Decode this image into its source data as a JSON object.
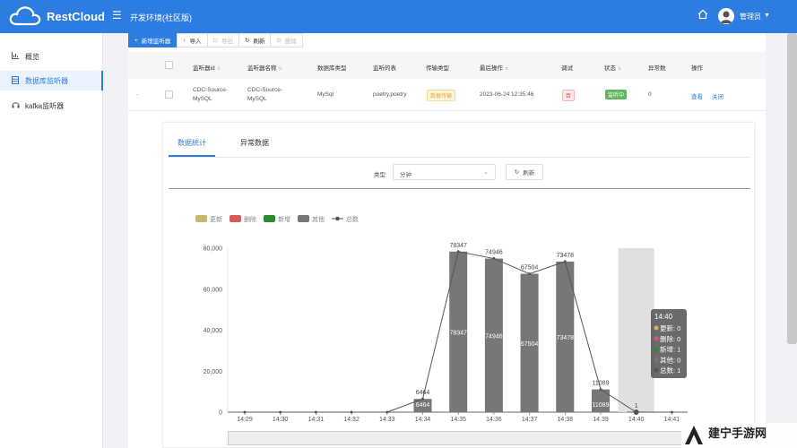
{
  "header": {
    "brand": "RestCloud",
    "environment": "开发环境(社区版)",
    "user": "管理员"
  },
  "sidebar": {
    "items": [
      {
        "label": "概览",
        "icon": "bar-chart-icon"
      },
      {
        "label": "数据库监听器",
        "icon": "database-icon",
        "active": true
      },
      {
        "label": "kafka监听器",
        "icon": "headset-icon"
      }
    ]
  },
  "toolbar": {
    "add_label": "新增监听器",
    "import_label": "导入",
    "export_label": "导出",
    "refresh_label": "刷新",
    "delete_label": "删除"
  },
  "table": {
    "headers": [
      "监听器id",
      "监听器名称",
      "数据库类型",
      "监听的表",
      "传输类型",
      "最后操作",
      "调试",
      "状态",
      "异常数",
      "操作"
    ],
    "row": {
      "id": "CDC-Source-MySQL",
      "name": "CDC-Source-MySQL",
      "db_type": "MySql",
      "table": "poetry.poetry",
      "transfer_type": "数据传输",
      "last_op": "2023-06-24 12:35:46",
      "debug": "否",
      "status": "监听中",
      "errors": "0",
      "action_view": "查看",
      "action_close": "关闭"
    }
  },
  "detail": {
    "tab_stats": "数据统计",
    "tab_errors": "异常数据",
    "type_label": "类型:",
    "type_value": "分钟",
    "refresh_label": "刷新"
  },
  "chart_data": {
    "type": "bar",
    "categories": [
      "14:29",
      "14:30",
      "14:31",
      "14:32",
      "14:33",
      "14:34",
      "14:35",
      "14:36",
      "14:37",
      "14:38",
      "14:39",
      "14:40",
      "14:41"
    ],
    "series": [
      {
        "name": "更新",
        "values": [
          0,
          0,
          0,
          0,
          0,
          0,
          0,
          0,
          0,
          0,
          0,
          0,
          0
        ],
        "color": "#c5b66f"
      },
      {
        "name": "删除",
        "values": [
          0,
          0,
          0,
          0,
          0,
          0,
          0,
          0,
          0,
          0,
          0,
          0,
          0
        ],
        "color": "#d55b5b"
      },
      {
        "name": "新增",
        "values": [
          0,
          0,
          0,
          0,
          0,
          0,
          0,
          0,
          0,
          0,
          0,
          1,
          0
        ],
        "color": "#2e8b2e"
      },
      {
        "name": "其他",
        "values": [
          0,
          0,
          0,
          0,
          0,
          6464,
          78347,
          74946,
          67504,
          73478,
          11089,
          0,
          0
        ],
        "color": "#777777"
      },
      {
        "name": "总数",
        "values": [
          0,
          0,
          0,
          0,
          0,
          6464,
          78347,
          74946,
          67504,
          73478,
          11089,
          1,
          0
        ],
        "color": "#555555",
        "kind": "line"
      }
    ],
    "yticks": [
      "0",
      "20,000",
      "40,000",
      "60,000",
      "80,000"
    ],
    "ylim": [
      0,
      80000
    ],
    "legend": "top-left",
    "highlight": "14:40",
    "tooltip": {
      "title": "14:40",
      "lines": [
        "更新: 0",
        "删除: 0",
        "新增: 1",
        "其他: 0",
        "总数: 1"
      ]
    }
  },
  "watermark": "建宁手游网"
}
